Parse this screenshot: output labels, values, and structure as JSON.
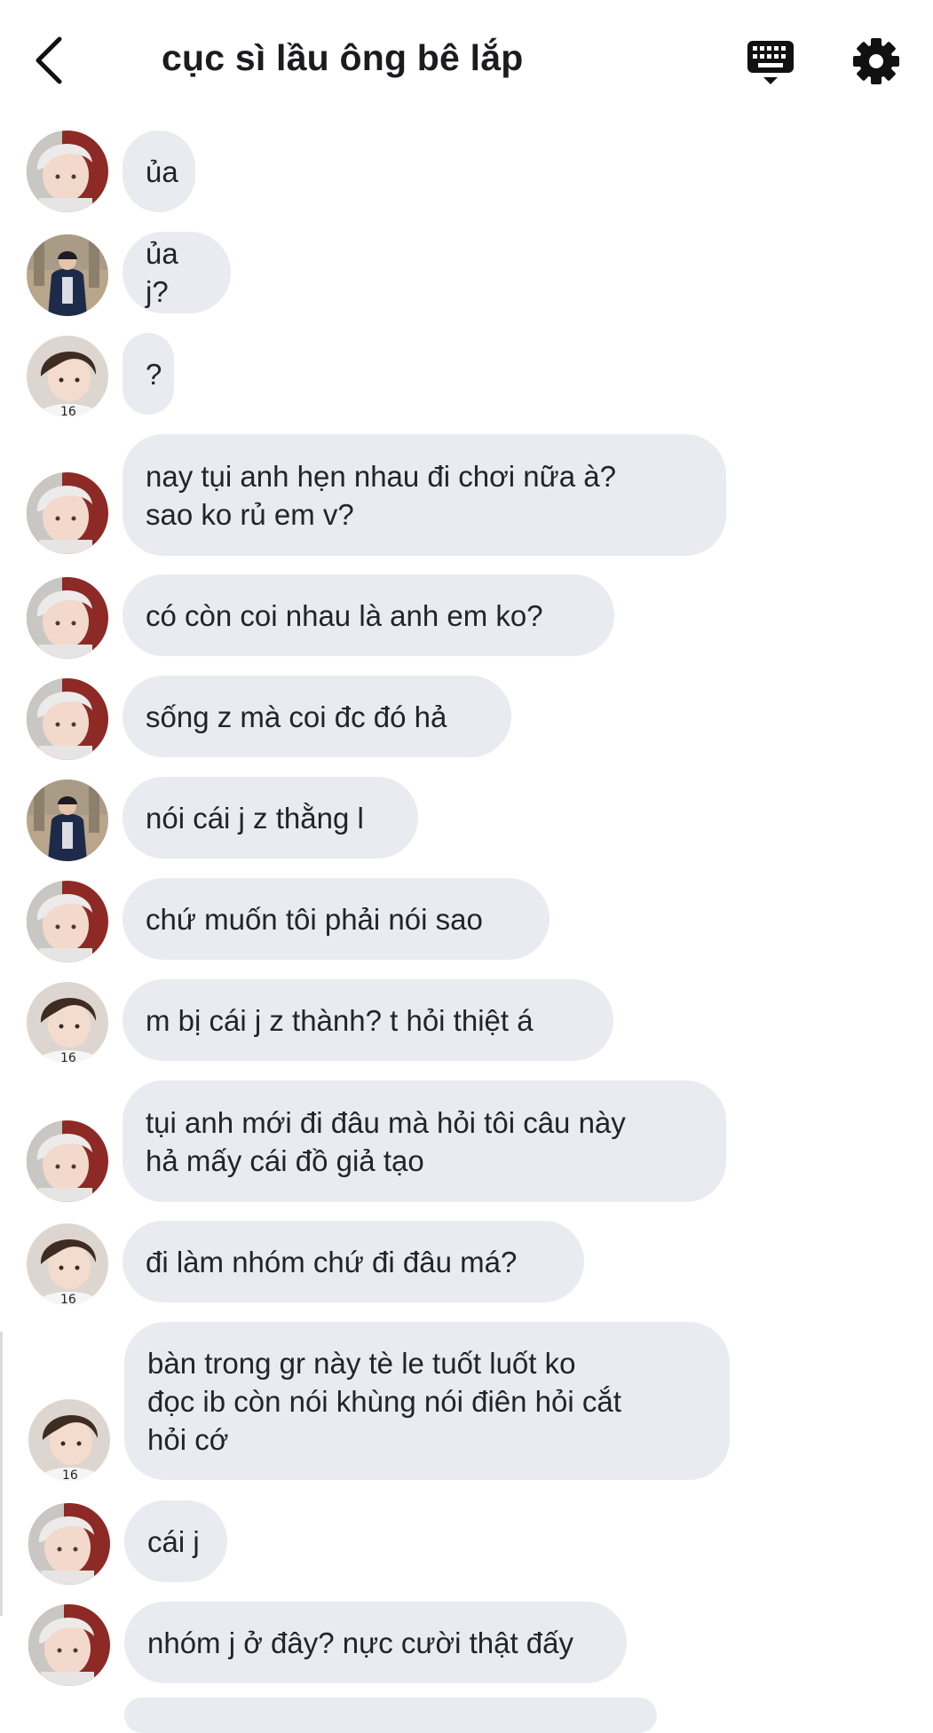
{
  "header": {
    "title": "cục sì lầu ông bê lắp",
    "back_icon": "chevron-left-icon",
    "keyboard_icon": "keyboard-icon",
    "settings_icon": "gear-icon"
  },
  "colors": {
    "bubble": "#e9ebf0",
    "text": "#23232a",
    "background": "#ffffff"
  },
  "messages": [
    {
      "sender": "silver-hair",
      "text": "ủa"
    },
    {
      "sender": "jacket",
      "text": "ủa j?"
    },
    {
      "sender": "brown-hair",
      "text": "?"
    },
    {
      "sender": "silver-hair",
      "text": "nay tụi anh hẹn nhau đi chơi nữa à?\nsao ko rủ em v?"
    },
    {
      "sender": "silver-hair",
      "text": "có còn coi nhau là anh em ko?"
    },
    {
      "sender": "silver-hair",
      "text": "sống z mà coi đc đó hả"
    },
    {
      "sender": "jacket",
      "text": "nói cái j z thằng l"
    },
    {
      "sender": "silver-hair",
      "text": "chứ muốn tôi phải nói sao"
    },
    {
      "sender": "brown-hair",
      "text": "m bị cái j z thành? t hỏi thiệt á"
    },
    {
      "sender": "silver-hair",
      "text": "tụi anh mới đi đâu mà hỏi tôi câu này\nhả mấy cái đồ giả tạo"
    },
    {
      "sender": "brown-hair",
      "text": "đi làm nhóm chứ đi đâu má?"
    },
    {
      "sender": "brown-hair",
      "text": "bàn trong gr này tè le tuốt luốt ko\nđọc ib còn nói khùng nói điên hỏi cắt\nhỏi cớ"
    },
    {
      "sender": "silver-hair",
      "text": "cái j"
    },
    {
      "sender": "silver-hair",
      "text": "nhóm j ở đây? nực cười thật đấy"
    }
  ]
}
